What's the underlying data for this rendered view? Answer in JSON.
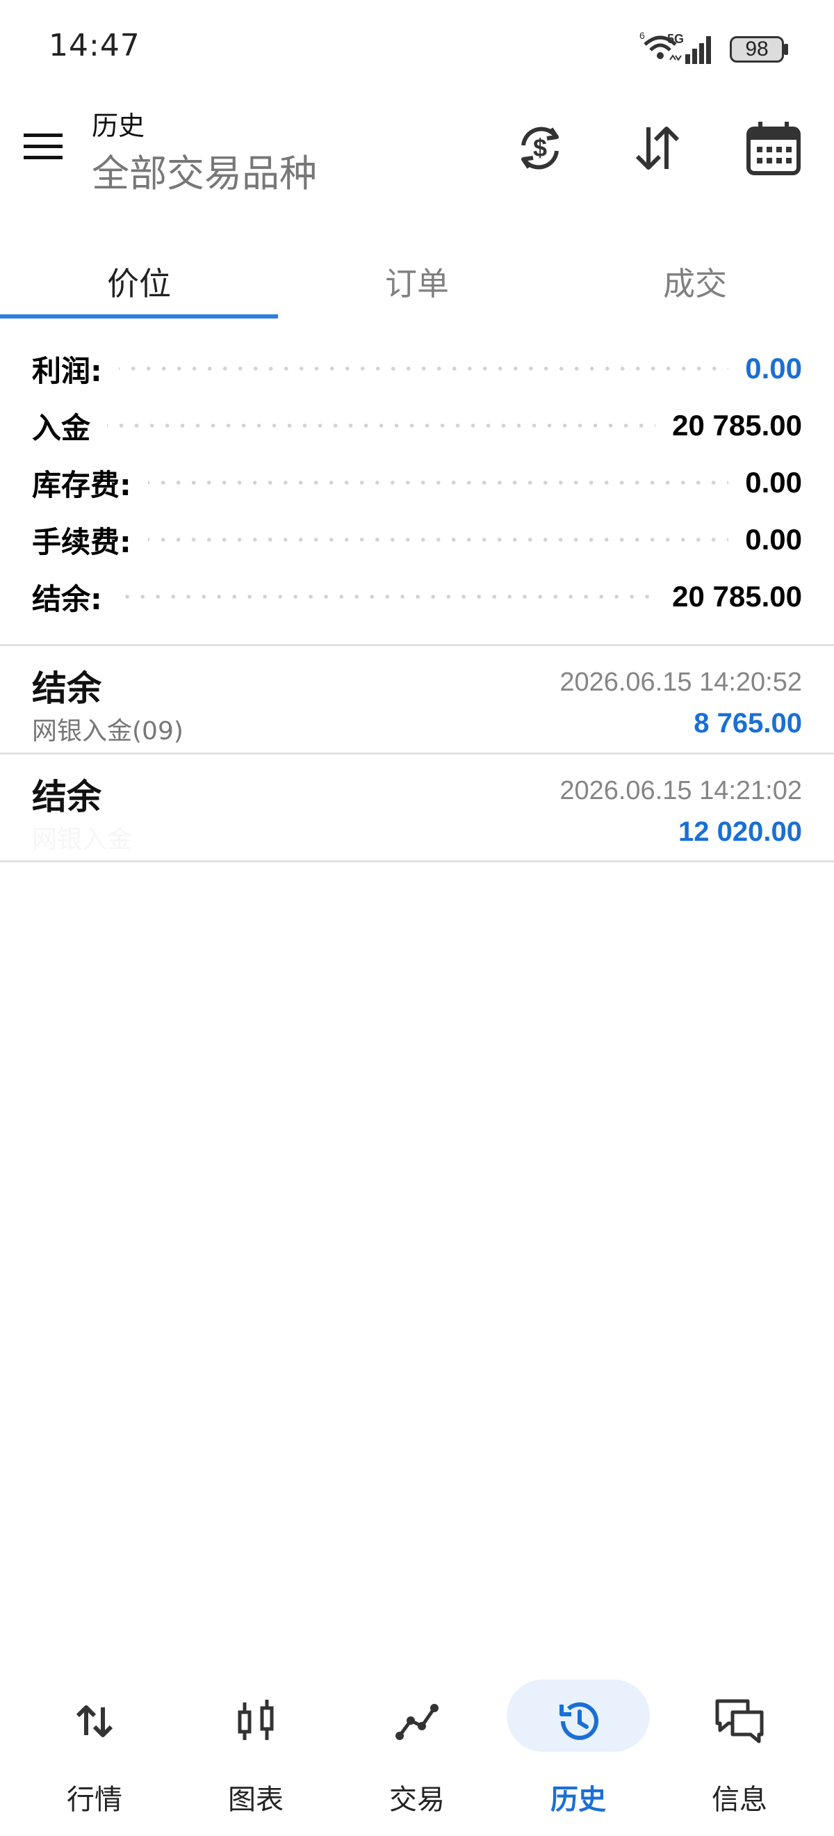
{
  "status_bar": {
    "time": "14:47",
    "battery": "98",
    "network": "5G"
  },
  "app_bar": {
    "title": "历史",
    "subtitle": "全部交易品种"
  },
  "tabs": [
    {
      "label": "价位",
      "active": true
    },
    {
      "label": "订单",
      "active": false
    },
    {
      "label": "成交",
      "active": false
    }
  ],
  "summary": [
    {
      "label": "利润:",
      "value": "0.00",
      "highlight": true
    },
    {
      "label": "入金",
      "value": "20 785.00",
      "highlight": false
    },
    {
      "label": "库存费:",
      "value": "0.00",
      "highlight": false
    },
    {
      "label": "手续费:",
      "value": "0.00",
      "highlight": false
    },
    {
      "label": "结余:",
      "value": "20 785.00",
      "highlight": false
    }
  ],
  "records": [
    {
      "title": "结余",
      "comment": "网银入金(09)",
      "datetime": "2026.06.15 14:20:52",
      "amount": "8 765.00"
    },
    {
      "title": "结余",
      "comment": "网银入金",
      "datetime": "2026.06.15 14:21:02",
      "amount": "12 020.00"
    }
  ],
  "bottom_nav": [
    {
      "label": "行情",
      "icon": "quotes-arrows-icon",
      "active": false
    },
    {
      "label": "图表",
      "icon": "candlestick-chart-icon",
      "active": false
    },
    {
      "label": "交易",
      "icon": "trade-line-icon",
      "active": false
    },
    {
      "label": "历史",
      "icon": "history-clock-icon",
      "active": true
    },
    {
      "label": "信息",
      "icon": "chat-messages-icon",
      "active": false
    }
  ],
  "colors": {
    "accent": "#1a6fd4",
    "tab_indicator": "#2f7fe0",
    "active_pill": "#e8f1fc"
  }
}
